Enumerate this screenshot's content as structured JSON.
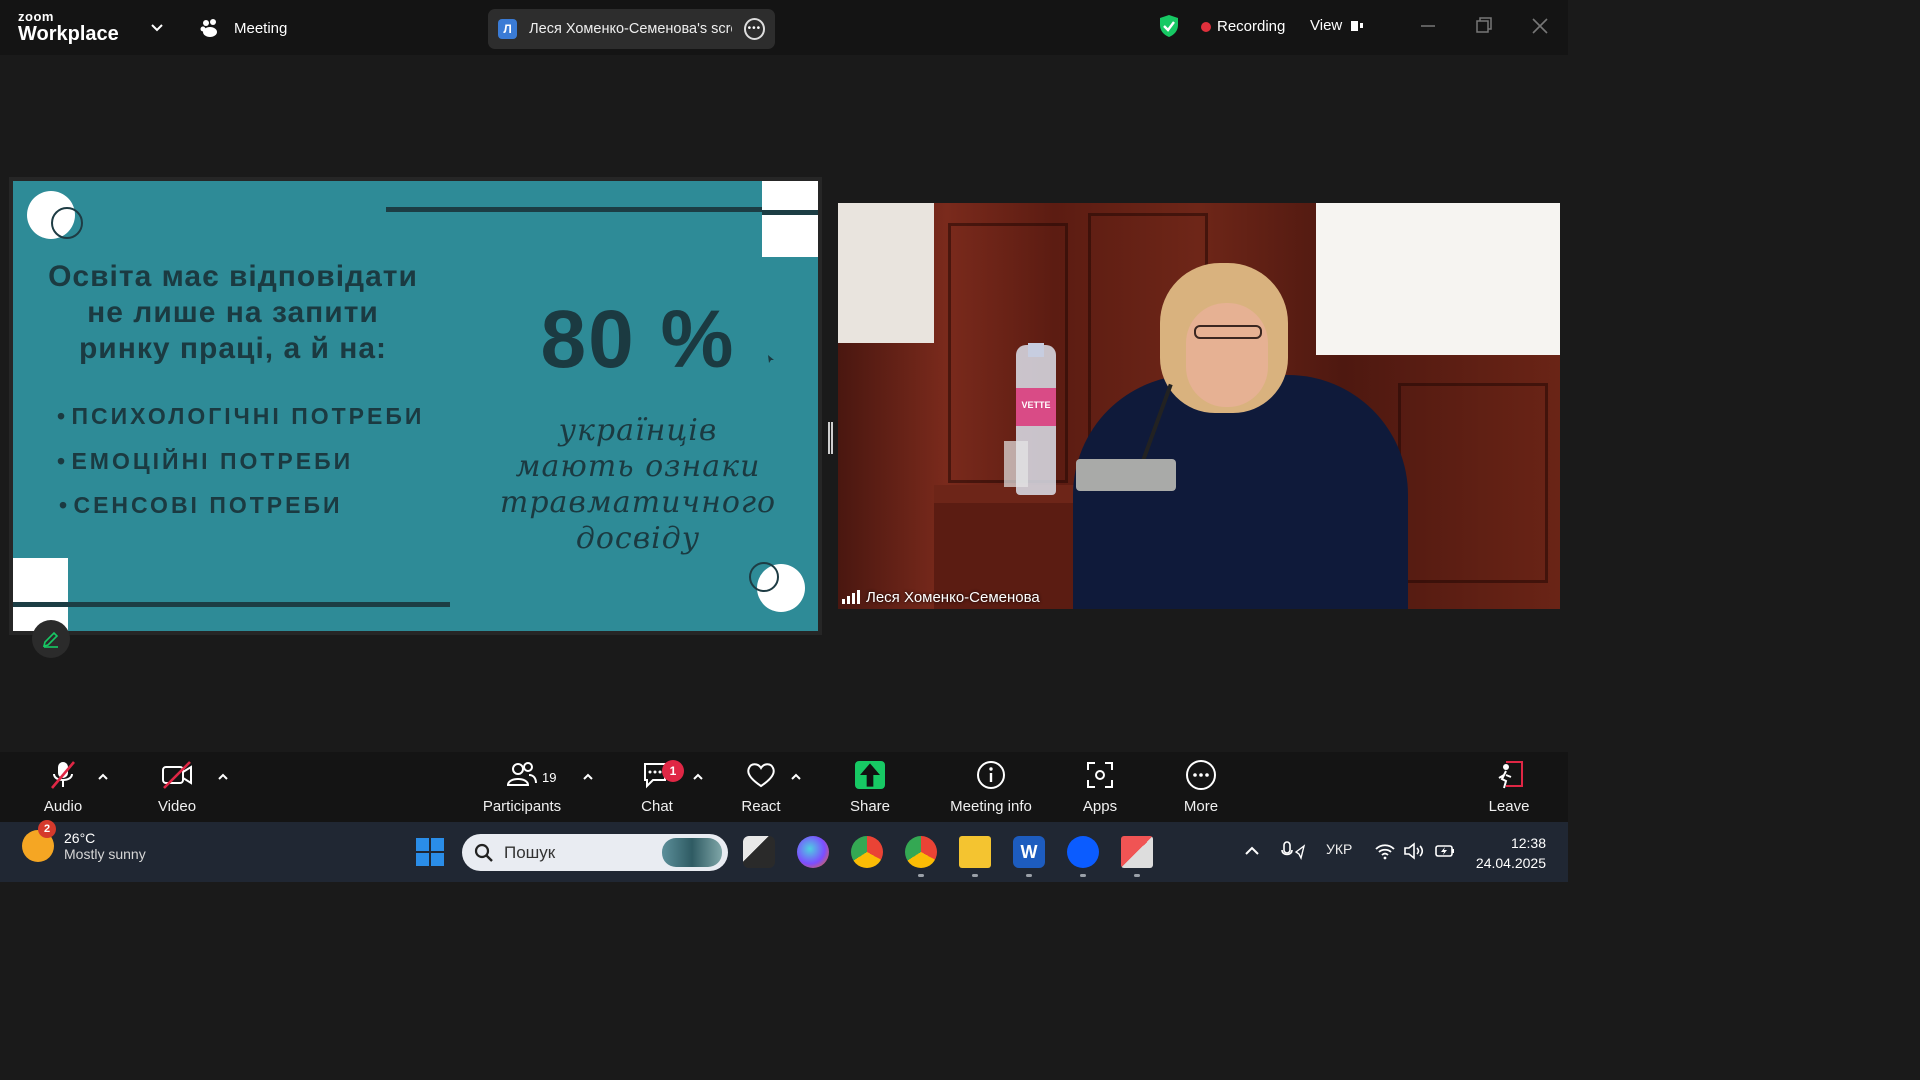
{
  "topbar": {
    "logo_small": "zoom",
    "logo_large": "Workplace",
    "meeting_label": "Meeting",
    "share_avatar_letter": "Л",
    "share_label": "Леся Хоменко-Семенова's scre",
    "recording_label": "Recording",
    "view_label": "View"
  },
  "slide": {
    "heading_lines": [
      "Освіта має відповідати",
      "не лише на запити",
      "ринку праці, а й на:"
    ],
    "bullets": [
      "ПСИХОЛОГІЧНІ ПОТРЕБИ",
      "ЕМОЦІЙНІ ПОТРЕБИ",
      "СЕНСОВІ ПОТРЕБИ"
    ],
    "stat": "80 %",
    "stat_caption_lines": [
      "українців",
      "мають ознаки",
      "травматичного",
      "досвіду"
    ]
  },
  "video": {
    "participant_name": "Леся Хоменко-Семенова",
    "bottle_text": "VETTE"
  },
  "toolbar": {
    "audio": "Audio",
    "video": "Video",
    "participants": "Participants",
    "participants_count": "19",
    "chat": "Chat",
    "chat_badge": "1",
    "react": "React",
    "share": "Share",
    "meeting_info": "Meeting info",
    "apps": "Apps",
    "more": "More",
    "leave": "Leave"
  },
  "taskbar": {
    "weather_badge": "2",
    "temperature": "26°C",
    "weather_desc": "Mostly sunny",
    "search_placeholder": "Пошук",
    "language": "УКР",
    "time": "12:38",
    "date": "24.04.2025"
  },
  "colors": {
    "slide_bg": "#2e8b97",
    "slide_text": "#1b3a41",
    "recording": "#e0303c",
    "share_green": "#17c964",
    "chat_badge": "#e02745",
    "secure_shield": "#17c964"
  }
}
